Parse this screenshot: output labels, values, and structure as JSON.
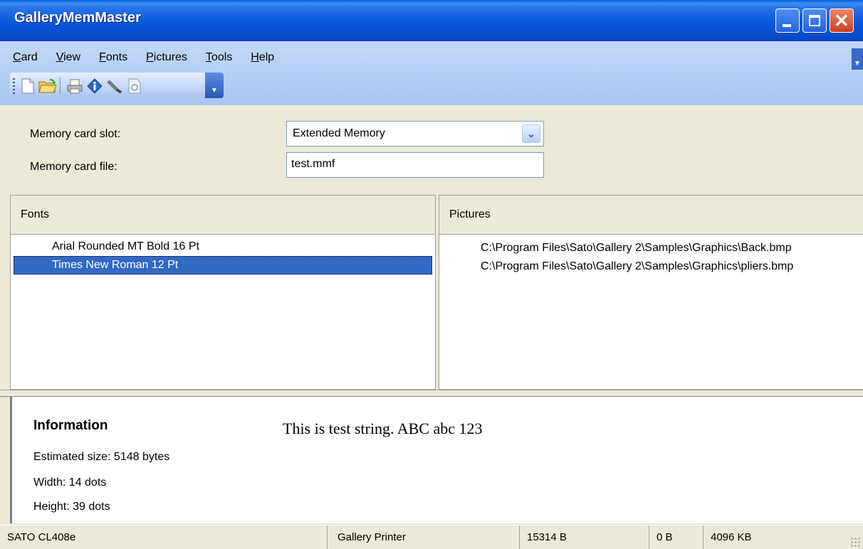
{
  "window": {
    "title": "GalleryMemMaster"
  },
  "menu": {
    "items": [
      {
        "accel": "C",
        "rest": "ard"
      },
      {
        "accel": "V",
        "rest": "iew"
      },
      {
        "accel": "F",
        "rest": "onts"
      },
      {
        "accel": "P",
        "rest": "ictures"
      },
      {
        "accel": "T",
        "rest": "ools"
      },
      {
        "accel": "H",
        "rest": "elp"
      }
    ]
  },
  "toolbar": {
    "icons": [
      "new-document-icon",
      "open-folder-icon",
      "print-icon",
      "info-icon",
      "brush-icon",
      "refresh-icon"
    ]
  },
  "form": {
    "slot_label": "Memory card slot:",
    "slot_value": "Extended Memory",
    "file_label": "Memory card file:",
    "file_value": "test.mmf"
  },
  "fonts_panel": {
    "header": "Fonts",
    "items": [
      "Arial Rounded MT Bold 16 Pt",
      "Times New Roman 12 Pt"
    ],
    "selected_index": 1
  },
  "pictures_panel": {
    "header": "Pictures",
    "items": [
      "C:\\Program Files\\Sato\\Gallery 2\\Samples\\Graphics\\Back.bmp",
      "C:\\Program Files\\Sato\\Gallery 2\\Samples\\Graphics\\pliers.bmp"
    ]
  },
  "info": {
    "title": "Information",
    "size": "Estimated size: 5148 bytes",
    "width": "Width: 14 dots",
    "height": "Height: 39 dots",
    "sample": "This is test string. ABC abc 123"
  },
  "status": {
    "printer": "SATO CL408e",
    "driver": "Gallery Printer",
    "used": "15314 B",
    "free": "0 B",
    "total": "4096 KB"
  }
}
